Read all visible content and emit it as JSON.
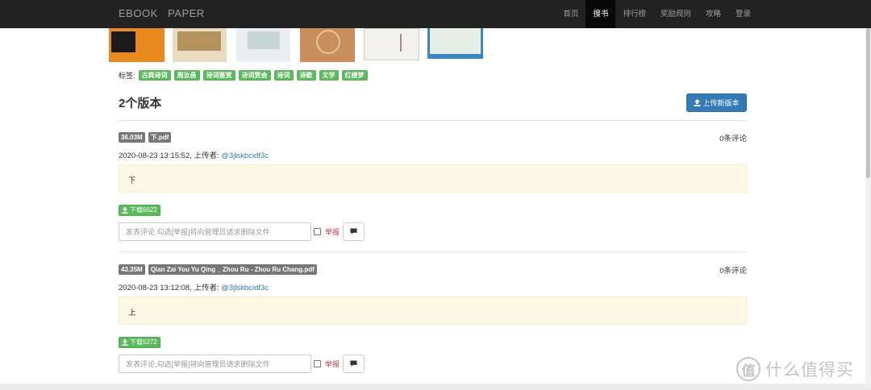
{
  "navbar": {
    "brand": "EBOOK   PAPER",
    "items": [
      {
        "label": "首页"
      },
      {
        "label": "搜书",
        "active": true
      },
      {
        "label": "排行榜"
      },
      {
        "label": "奖励规则"
      },
      {
        "label": "攻略"
      },
      {
        "label": "登录"
      }
    ]
  },
  "tags": {
    "label": "标签:",
    "items": [
      "古典诗词",
      "周汝昌",
      "诗词鉴赏",
      "诗词赏会",
      "诗词",
      "诗歌",
      "文学",
      "红楼梦"
    ]
  },
  "versions_title": "2个版本",
  "upload_button": "上传新版本",
  "versions": [
    {
      "size": "36.03M",
      "filename": "下.pdf",
      "comments_count": "0条评论",
      "datetime": "2020-08-23 13:15:52,",
      "uploader_label": "上传者:",
      "uploader": "@3jlskbcidf3c",
      "description": "下",
      "download_label": "下载6622",
      "comment_placeholder": "发表评论,勾选[举报]将向管理员请求删除文件",
      "report_label": "举报"
    },
    {
      "size": "43.35M",
      "filename": "Qian Zai You Yu Qing _ Zhou Ru - Zhou Ru Chang.pdf",
      "comments_count": "0条评论",
      "datetime": "2020-08-23 13:12:08,",
      "uploader_label": "上传者:",
      "uploader": "@3jlskbcidf3c",
      "description": "上",
      "download_label": "下载5272",
      "comment_placeholder": "发表评论,勾选[举报]将向管理员请求删除文件",
      "report_label": "举报"
    }
  ],
  "watermark": {
    "icon_glyph": "值",
    "text": "什么值得买"
  },
  "colors": {
    "navbar": "#222222",
    "tag": "#5cb85c",
    "primary": "#337ab7",
    "badge": "#777777",
    "description_bg": "#fcf8e3",
    "report": "#a94442"
  }
}
